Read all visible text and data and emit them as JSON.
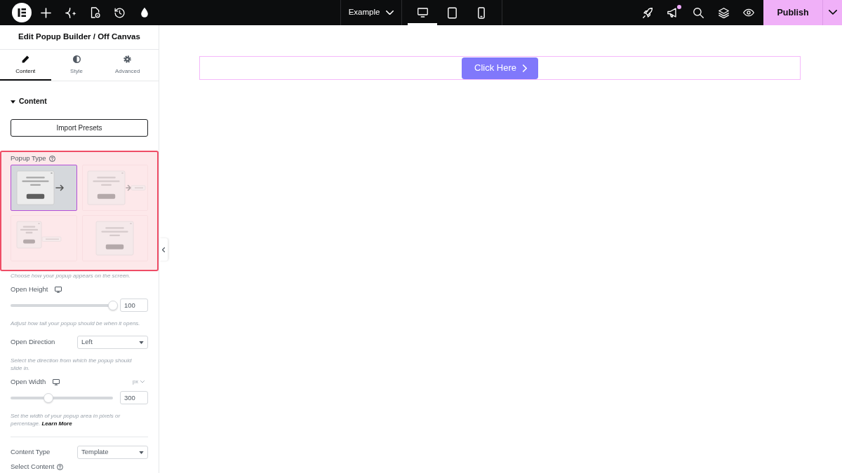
{
  "top_bar": {
    "page_selector": "Example",
    "devices": [
      {
        "kind": "desktop",
        "selected": true
      },
      {
        "kind": "tablet",
        "selected": false
      },
      {
        "kind": "mobile",
        "selected": false
      }
    ],
    "notification": true,
    "publish_button": "Publish"
  },
  "panel": {
    "title": "Edit Popup Builder / Off Canvas",
    "tabs": [
      {
        "label": "Content",
        "selected": true
      },
      {
        "label": "Style",
        "selected": false
      },
      {
        "label": "Advanced",
        "selected": false
      }
    ],
    "section": {
      "title": "Content",
      "expanded": true
    },
    "import_button": "Import Presets",
    "popup_type": {
      "label": "Popup Type",
      "info": true,
      "highlighted": true,
      "options": [
        {
          "kind": "arrow",
          "selected": true
        },
        {
          "kind": "arrow-bar",
          "selected": false
        },
        {
          "kind": "bar",
          "selected": false
        },
        {
          "kind": "center",
          "selected": false
        }
      ],
      "help": "Choose how your popup appears on the screen."
    },
    "fields": [
      {
        "kind": "slider",
        "label": "Open Height",
        "responsive": true,
        "level": 1,
        "value": "100",
        "help": "Adjust how tall your popup should be when it opens."
      },
      {
        "kind": "select",
        "label": "Open Direction",
        "value": "Left",
        "help": "Select the direction from which the popup should slide in."
      },
      {
        "kind": "slider",
        "label": "Open Width",
        "responsive": true,
        "unit": "px",
        "level": 0.37,
        "value": "300",
        "help": "Set the width of your popup area in pixels or percentage.",
        "help_link": "Learn More"
      },
      {
        "kind": "divider"
      },
      {
        "kind": "select",
        "label": "Content Type",
        "value": "Template"
      },
      {
        "kind": "heading",
        "label": "Select Content",
        "info": true
      }
    ]
  },
  "canvas": {
    "selected": true,
    "button": "Click Here"
  }
}
